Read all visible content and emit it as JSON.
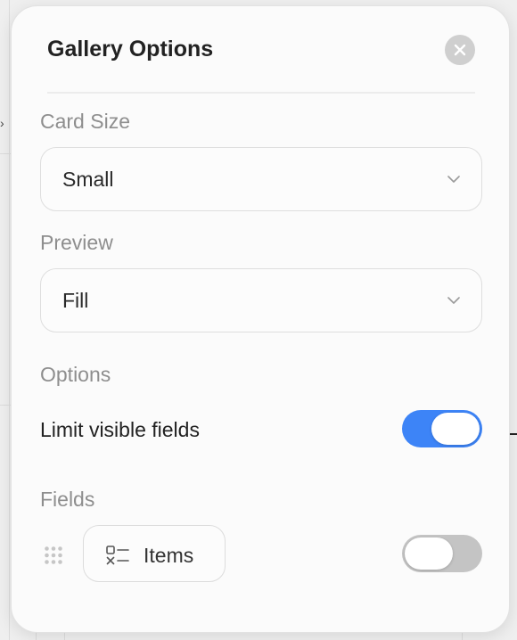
{
  "panel": {
    "title": "Gallery Options"
  },
  "card_size": {
    "label": "Card Size",
    "selected": "Small"
  },
  "preview": {
    "label": "Preview",
    "selected": "Fill"
  },
  "options": {
    "label": "Options",
    "limit_visible_fields": {
      "label": "Limit visible fields",
      "enabled": true
    }
  },
  "fields": {
    "label": "Fields",
    "items": [
      {
        "label": "Items",
        "icon": "checklist-icon",
        "visible": false
      }
    ]
  },
  "colors": {
    "toggle_on": "#3d84f7",
    "toggle_off": "#c4c4c4"
  },
  "icons": {
    "close": "close-icon",
    "select": "chevron-down-icon",
    "drag": "drag-handle-icon"
  }
}
